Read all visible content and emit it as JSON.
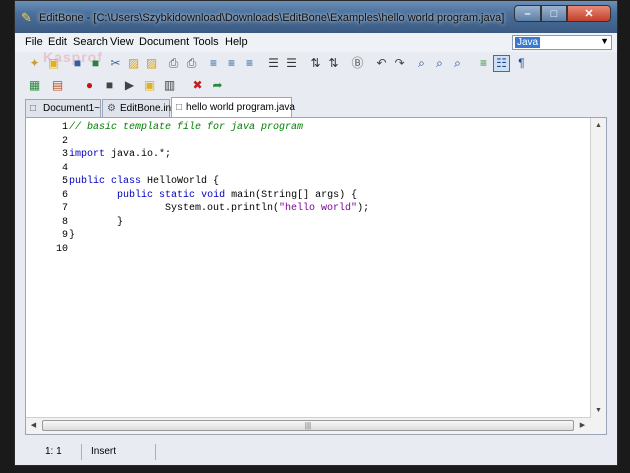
{
  "window": {
    "title": "EditBone - [C:\\Users\\Szybkidownload\\Downloads\\EditBone\\Examples\\hello world program.java]",
    "watermark": "Kasprof"
  },
  "controls": {
    "minimize": "–",
    "maximize": "□",
    "close": "✕"
  },
  "menu": [
    "File",
    "Edit",
    "Search",
    "View",
    "Document",
    "Tools",
    "Help"
  ],
  "language_select": {
    "value": "Java",
    "arrow": "▼"
  },
  "toolbar1": [
    {
      "name": "new-document-icon",
      "glyph": "✦",
      "color": "#c7a030"
    },
    {
      "name": "open-folder-icon",
      "glyph": "▣",
      "color": "#e0b020"
    },
    {
      "name": "save-icon",
      "glyph": "■",
      "color": "#3060a0"
    },
    {
      "name": "save-all-icon",
      "glyph": "■",
      "color": "#2a8040"
    },
    {
      "name": "save-as-icon",
      "glyph": "✂",
      "color": "#4060a0"
    },
    {
      "name": "close-icon",
      "glyph": "▨",
      "color": "#d0a020"
    },
    {
      "name": "close-all-icon",
      "glyph": "▨",
      "color": "#d0a020"
    },
    {
      "name": "print-icon",
      "glyph": "⎙",
      "color": "#556"
    },
    {
      "name": "print-preview-icon",
      "glyph": "⎙",
      "color": "#556"
    },
    {
      "name": "indent-increase-icon",
      "glyph": "≡",
      "color": "#1a5a9a"
    },
    {
      "name": "indent-decrease-icon",
      "glyph": "≡",
      "color": "#1a5a9a"
    },
    {
      "name": "sort-icon",
      "glyph": "≡",
      "color": "#1a5a9a"
    },
    {
      "name": "comment-icon",
      "glyph": "☰",
      "color": "#333"
    },
    {
      "name": "uncomment-icon",
      "glyph": "☰",
      "color": "#333"
    },
    {
      "name": "sort-ascending-icon",
      "glyph": "⇅",
      "color": "#333"
    },
    {
      "name": "sort-descending-icon",
      "glyph": "⇅",
      "color": "#333"
    },
    {
      "name": "case-toggle-icon",
      "glyph": "Ⓑ",
      "color": "#555"
    },
    {
      "name": "undo-icon",
      "glyph": "↶",
      "color": "#444"
    },
    {
      "name": "redo-icon",
      "glyph": "↷",
      "color": "#444"
    },
    {
      "name": "search-icon",
      "glyph": "⌕",
      "color": "#1a4a8a"
    },
    {
      "name": "replace-icon",
      "glyph": "⌕",
      "color": "#1a4a8a"
    },
    {
      "name": "search-again-icon",
      "glyph": "⌕",
      "color": "#1a4a8a"
    },
    {
      "name": "line-numbers-icon",
      "glyph": "≡",
      "color": "#2a8a3a"
    },
    {
      "name": "special-chars-icon",
      "glyph": "☷",
      "color": "#1a4a8a"
    },
    {
      "name": "paragraph-icon",
      "glyph": "¶",
      "color": "#1a4a8a"
    }
  ],
  "toolbar2": [
    {
      "name": "compare-icon",
      "glyph": "▦",
      "color": "#2a8a3a"
    },
    {
      "name": "macro-icon",
      "glyph": "▤",
      "color": "#c05020"
    },
    {
      "name": "record-icon",
      "glyph": "●",
      "color": "#d01010"
    },
    {
      "name": "stop-icon",
      "glyph": "■",
      "color": "#444"
    },
    {
      "name": "play-icon",
      "glyph": "▶",
      "color": "#444"
    },
    {
      "name": "open-macro-icon",
      "glyph": "▣",
      "color": "#e0b020"
    },
    {
      "name": "save-macro-icon",
      "glyph": "▥",
      "color": "#444"
    },
    {
      "name": "delete-macro-icon",
      "glyph": "✖",
      "color": "#c02020"
    },
    {
      "name": "export-icon",
      "glyph": "➦",
      "color": "#2a8a3a"
    }
  ],
  "tabs": [
    {
      "label": "Document1~",
      "icon": "□"
    },
    {
      "label": "EditBone.ini",
      "icon": "⚙"
    },
    {
      "label": "hello world program.java",
      "icon": "□"
    }
  ],
  "editor": {
    "line_numbers": [
      "1",
      "2",
      "3",
      "4",
      "5",
      "6",
      "7",
      "8",
      "9",
      "10"
    ],
    "lines": [
      [
        {
          "t": "// basic template file for java program",
          "c": "cm"
        }
      ],
      [],
      [
        {
          "t": "import",
          "c": "kw"
        },
        {
          "t": " java.io.*;",
          "c": ""
        }
      ],
      [],
      [
        {
          "t": "public",
          "c": "kw"
        },
        {
          "t": " ",
          "c": ""
        },
        {
          "t": "class",
          "c": "kw"
        },
        {
          "t": " HelloWorld {",
          "c": ""
        }
      ],
      [
        {
          "t": "        ",
          "c": ""
        },
        {
          "t": "public",
          "c": "kw"
        },
        {
          "t": " ",
          "c": ""
        },
        {
          "t": "static",
          "c": "kw"
        },
        {
          "t": " ",
          "c": ""
        },
        {
          "t": "void",
          "c": "kw"
        },
        {
          "t": " main(String[] args) {",
          "c": ""
        }
      ],
      [
        {
          "t": "                System.out.println(",
          "c": ""
        },
        {
          "t": "\"hello world\"",
          "c": "st"
        },
        {
          "t": ");",
          "c": ""
        }
      ],
      [
        {
          "t": "        }",
          "c": ""
        }
      ],
      [
        {
          "t": "}",
          "c": ""
        }
      ],
      []
    ],
    "scroll_grip": "|||",
    "arrows": {
      "up": "▲",
      "down": "▼",
      "left": "◀",
      "right": "▶"
    }
  },
  "status": {
    "position": "1: 1",
    "mode": "Insert"
  }
}
